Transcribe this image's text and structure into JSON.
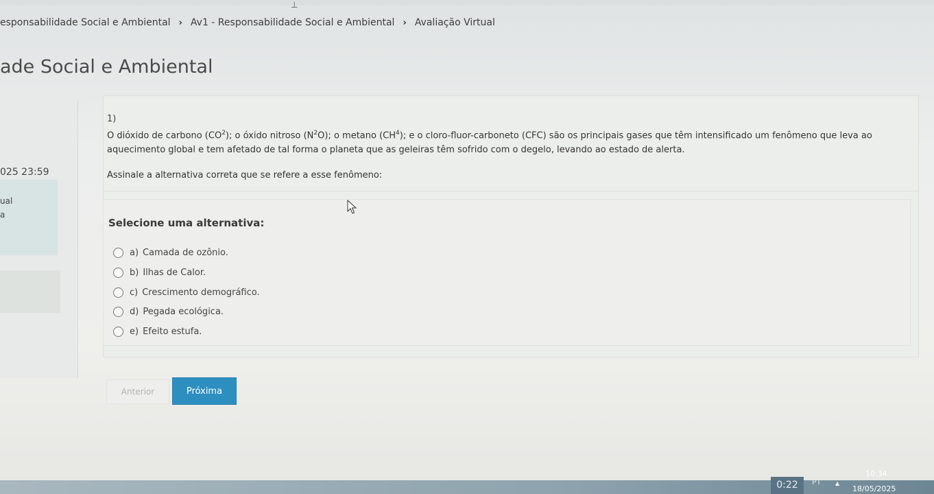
{
  "breadcrumb": {
    "items": [
      "esponsabilidade Social e Ambiental",
      "Av1 - Responsabilidade Social e Ambiental",
      "Avaliação Virtual"
    ],
    "separator": "›"
  },
  "page_title": "ade Social e Ambiental",
  "left_panel": {
    "date": "025 23:59",
    "block_line1": "ual",
    "block_line2": "a"
  },
  "question": {
    "number": "1)",
    "text_part1": "O dióxido de carbono (CO",
    "sup1": "2",
    "text_part2": "); o óxido nitroso (N",
    "sup2": "2",
    "text_part3": "O); o metano (CH",
    "sup3": "4",
    "text_part4": "); e o cloro-fluor-carboneto (CFC) são os principais gases que têm intensificado um fenômeno que leva ao aquecimento global e tem afetado de tal forma o planeta que as geleiras têm sofrido com o degelo, levando ao estado de alerta.",
    "instruction": "Assinale a alternativa correta que se refere a esse fenômeno:"
  },
  "options": {
    "label": "Selecione uma alternativa:",
    "items": [
      {
        "letter": "a)",
        "text": "Camada de ozônio."
      },
      {
        "letter": "b)",
        "text": "Ilhas de Calor."
      },
      {
        "letter": "c)",
        "text": "Crescimento demográfico."
      },
      {
        "letter": "d)",
        "text": "Pegada ecológica."
      },
      {
        "letter": "e)",
        "text": "Efeito estufa."
      }
    ]
  },
  "nav": {
    "prev_label": "Anterior",
    "next_label": "Próxima"
  },
  "taskbar": {
    "timer": "0:22",
    "lang": "PT",
    "time": "10:34",
    "date": "18/05/2025"
  },
  "colors": {
    "accent": "#2d8fc0",
    "background": "#eceeeb"
  },
  "icons": {
    "cursor": "mouse-pointer-icon",
    "breadcrumb_sep": "chevron-right-icon",
    "tray": "caret-up-icon"
  }
}
